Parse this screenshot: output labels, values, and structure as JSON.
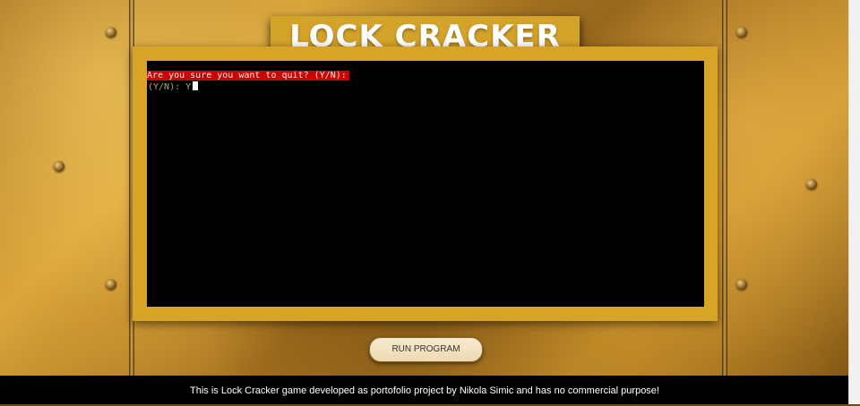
{
  "header": {
    "title": "LOCK CRACKER"
  },
  "terminal": {
    "prompt_line": "Are you sure you want to quit? (Y/N):",
    "input_line": "(Y/N): Y"
  },
  "controls": {
    "run_button_label": "RUN PROGRAM"
  },
  "footer": {
    "text": "This is Lock Cracker game developed as portofolio project by Nikola Simic and has no commercial purpose!"
  },
  "colors": {
    "frame": "#d8a427",
    "terminal_background": "#000000",
    "prompt_highlight": "#cc0000",
    "footer_background": "#000000"
  }
}
